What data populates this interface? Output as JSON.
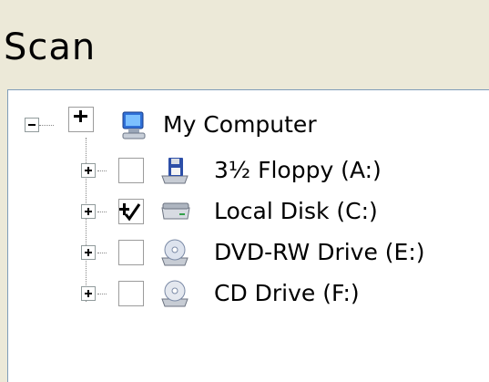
{
  "header": {
    "title": "Scan"
  },
  "tree": {
    "root": {
      "label": "My Computer",
      "expanded": true,
      "checkbox_state": "partial",
      "icon": "computer-icon"
    },
    "children": [
      {
        "label": "3½ Floppy (A:)",
        "expanded": false,
        "checkbox_state": "unchecked",
        "icon": "floppy-drive-icon"
      },
      {
        "label": "Local Disk (C:)",
        "expanded": false,
        "checkbox_state": "partial",
        "icon": "hard-disk-icon"
      },
      {
        "label": "DVD-RW Drive (E:)",
        "expanded": false,
        "checkbox_state": "unchecked",
        "icon": "dvd-drive-icon"
      },
      {
        "label": "CD Drive (F:)",
        "expanded": false,
        "checkbox_state": "unchecked",
        "icon": "cd-drive-icon"
      }
    ]
  }
}
